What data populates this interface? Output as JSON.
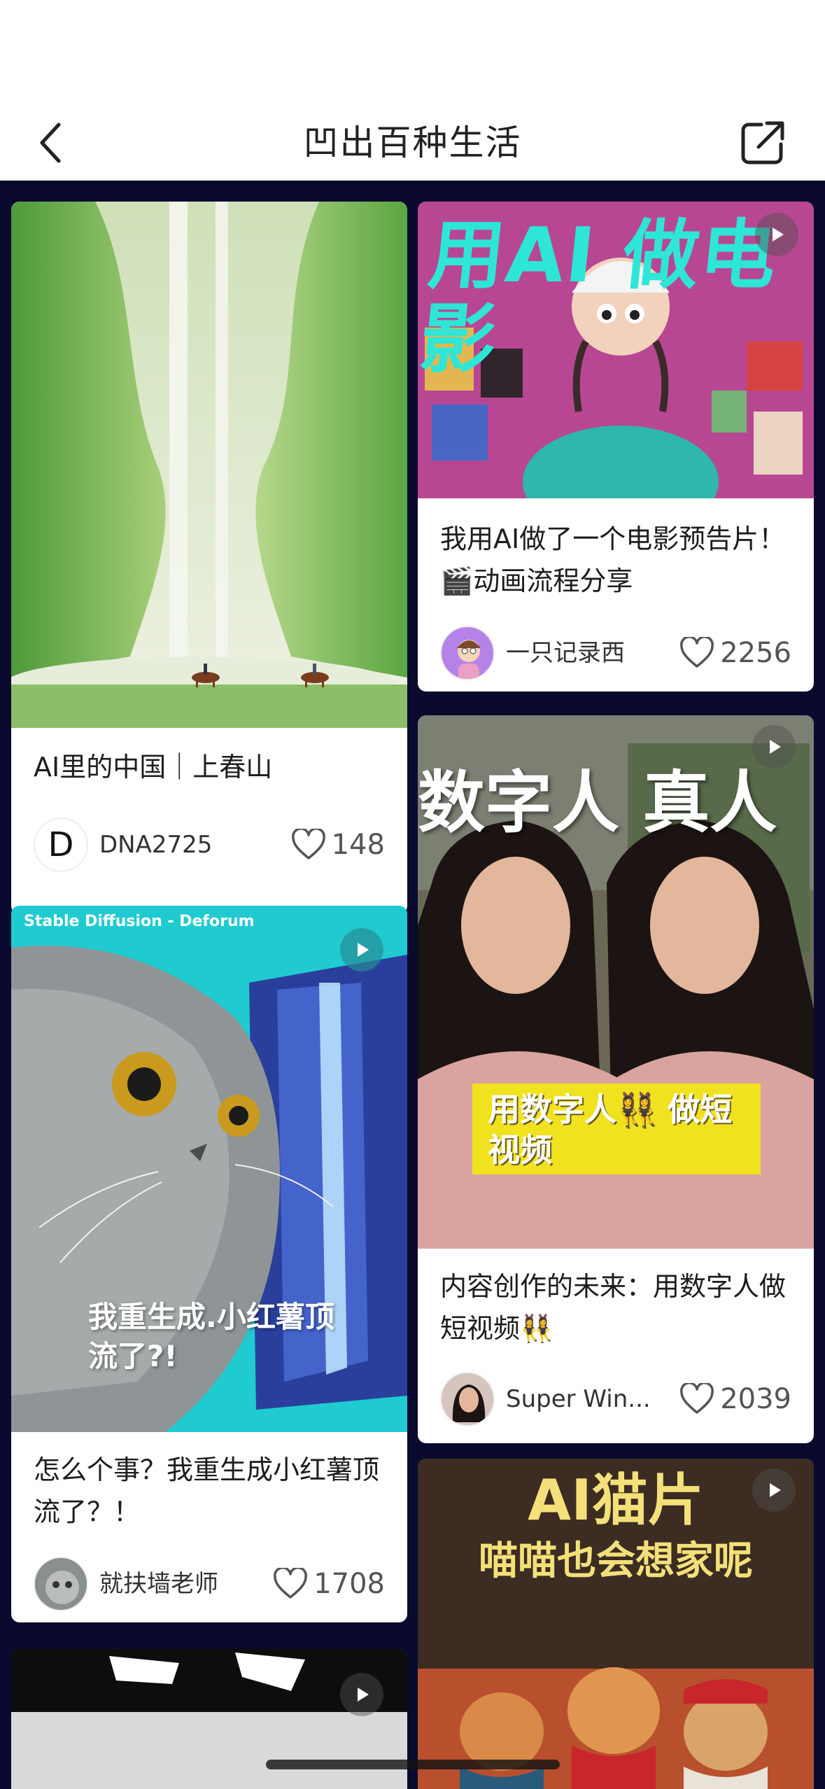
{
  "header": {
    "title": "凹出百种生活"
  },
  "feed": {
    "cards": [
      {
        "title": "AI里的中国｜上春山",
        "author": "DNA2725",
        "avatar_letter": "D",
        "likes": "148",
        "is_video": false
      },
      {
        "title": "我用AI做了一个电影预告片！🎬动画流程分享",
        "author": "一只记录西",
        "likes": "2256",
        "is_video": true,
        "overlay": "用AI 做电影"
      },
      {
        "title": "怎么个事？我重生成小红薯顶流了？！",
        "author": "就扶墙老师",
        "likes": "1708",
        "is_video": true,
        "overlay_top": "Stable Diffusion - Deforum",
        "overlay_caption": "我重生成.小红薯顶流了?!"
      },
      {
        "title": "内容创作的未来：用数字人做短视频👯‍♀️",
        "author": "Super Win...",
        "likes": "2039",
        "is_video": true,
        "overlay_top": "数字人 真人",
        "overlay_banner": "用数字人👯‍♀️ 做短视频"
      },
      {
        "is_video": true,
        "overlay_top": "AI猫片",
        "overlay_sub": "喵喵也会想家呢"
      },
      {
        "is_video": true
      }
    ]
  },
  "colors": {
    "feed_bg": "#0a0a2e",
    "accent_teal": "#2ee6d6"
  }
}
